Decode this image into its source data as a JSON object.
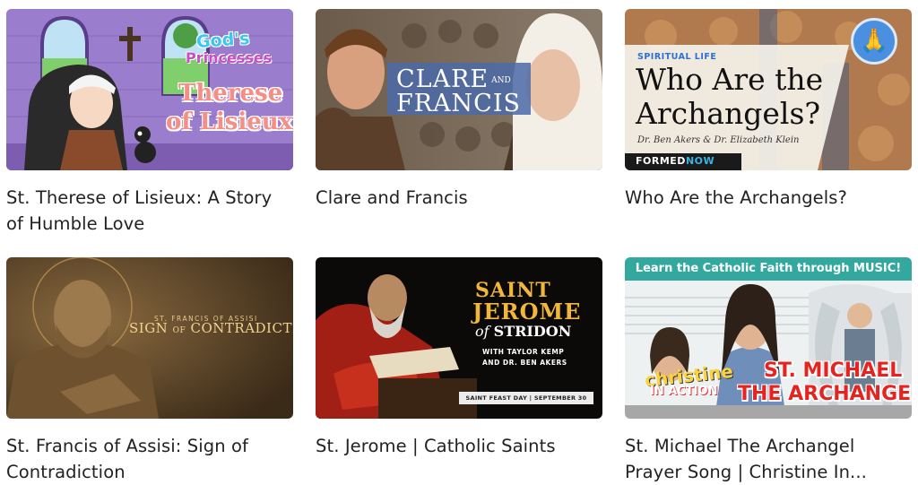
{
  "cards": [
    {
      "title": "St. Therese of Lisieux: A Story of Humble Love",
      "thumb": {
        "logo_line1": "God's",
        "logo_line2": "Princesses",
        "name_line1": "Therese",
        "name_line2": "of Lisieux"
      },
      "thumb_icon": "nun-cartoon-image"
    },
    {
      "title": "Clare and Francis",
      "thumb": {
        "title_left": "CLARE",
        "title_and": "AND",
        "title_right": "FRANCIS"
      },
      "thumb_icon": "film-still-image"
    },
    {
      "title": "Who Are the Archangels?",
      "thumb": {
        "kicker": "SPIRITUAL LIFE",
        "headline_line1": "Who Are the",
        "headline_line2": "Archangels?",
        "authors": "Dr. Ben Akers & Dr. Elizabeth Klein",
        "brand_a": "FORMED",
        "brand_b": "NOW"
      },
      "thumb_icon": "praying-hands-icon"
    },
    {
      "title": "St. Francis of Assisi: Sign of Contradiction",
      "thumb": {
        "small": "ST. FRANCIS OF ASSISI",
        "big_a": "SIGN",
        "big_b": "OF",
        "big_c": "CONTRADICTION"
      },
      "thumb_icon": "statue-image"
    },
    {
      "title": "St. Jerome | Catholic Saints",
      "thumb": {
        "line1": "SAINT",
        "line2": "JEROME",
        "line3_a": "of",
        "line3_b": "STRIDON",
        "with_line1": "WITH TAYLOR KEMP",
        "with_line2": "AND DR. BEN AKERS",
        "feast_a": "SAINT FEAST DAY",
        "feast_b": "SEPTEMBER 30"
      },
      "thumb_icon": "painting-image"
    },
    {
      "title": "St. Michael The Archangel Prayer Song | Christine In...",
      "thumb": {
        "banner": "Learn the Catholic Faith through MUSIC!",
        "christine": "christine",
        "in_action": "IN ACTION",
        "st_michael": "ST. MICHAEL",
        "the_archangel": "THE ARCHANGEL"
      },
      "thumb_icon": "archangel-image"
    }
  ],
  "colors": {
    "title_text": "#222222",
    "accent_blue": "#4a8fe0",
    "music_banner": "#33a89e"
  }
}
